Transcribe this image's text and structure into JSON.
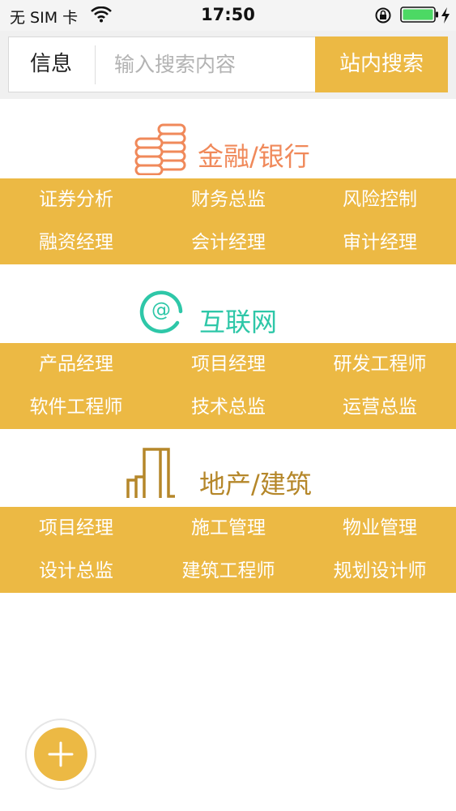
{
  "status_bar": {
    "carrier": "无 SIM 卡",
    "time": "17:50",
    "icons": [
      "wifi-icon",
      "orientation-lock-icon",
      "battery-icon",
      "charging-bolt-icon"
    ],
    "battery_color": "#4cd964"
  },
  "search": {
    "category": "信息",
    "placeholder": "输入搜索内容",
    "button_label": "站内搜索"
  },
  "colors": {
    "accent": "#ecb944",
    "finance": "#f0895a",
    "internet": "#2ec7a8",
    "realestate": "#b5872a"
  },
  "categories": [
    {
      "title": "金融/银行",
      "icon": "coins-icon",
      "jobs": [
        "证券分析",
        "财务总监",
        "风险控制",
        "融资经理",
        "会计经理",
        "审计经理"
      ]
    },
    {
      "title": "互联网",
      "icon": "at-sign-icon",
      "jobs": [
        "产品经理",
        "项目经理",
        "研发工程师",
        "软件工程师",
        "技术总监",
        "运营总监"
      ]
    },
    {
      "title": "地产/建筑",
      "icon": "building-icon",
      "jobs": [
        "项目经理",
        "施工管理",
        "物业管理",
        "设计总监",
        "建筑工程师",
        "规划设计师"
      ]
    }
  ],
  "fab": {
    "icon": "plus-icon"
  }
}
